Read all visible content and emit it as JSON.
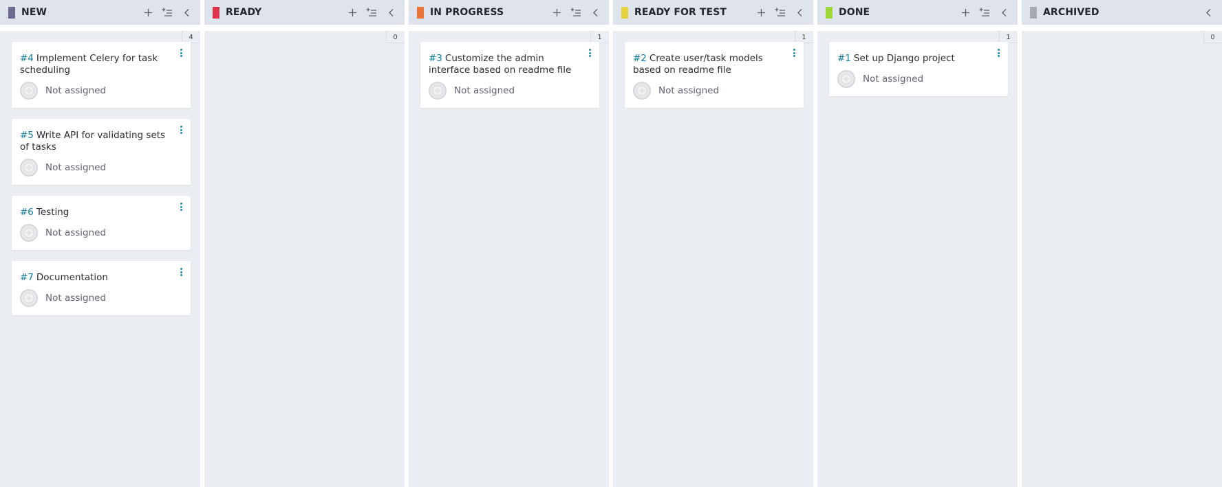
{
  "colors": {
    "header_bg": "#dfe3ec",
    "column_bg": "#eaedf2",
    "card_ref": "#0e7ea3",
    "card_menu": "#1b8fb0"
  },
  "columns": [
    {
      "title": "NEW",
      "color": "#6f6b8f",
      "count": "4",
      "show_add": true,
      "cards": [
        {
          "ref": "#4",
          "title": "Implement Celery for task scheduling",
          "assignee": "Not assigned"
        },
        {
          "ref": "#5",
          "title": "Write API for validating sets of tasks",
          "assignee": "Not assigned"
        },
        {
          "ref": "#6",
          "title": "Testing",
          "assignee": "Not assigned"
        },
        {
          "ref": "#7",
          "title": "Documentation",
          "assignee": "Not assigned"
        }
      ]
    },
    {
      "title": "READY",
      "color": "#e0344a",
      "count": "0",
      "show_add": true,
      "cards": []
    },
    {
      "title": "IN PROGRESS",
      "color": "#e8763a",
      "count": "1",
      "show_add": true,
      "cards": [
        {
          "ref": "#3",
          "title": "Customize the admin interface based on readme file",
          "assignee": "Not assigned"
        }
      ]
    },
    {
      "title": "READY FOR TEST",
      "color": "#e6d23a",
      "count": "1",
      "show_add": true,
      "cards": [
        {
          "ref": "#2",
          "title": "Create user/task models based on readme file",
          "assignee": "Not assigned"
        }
      ]
    },
    {
      "title": "DONE",
      "color": "#9fd63b",
      "count": "1",
      "show_add": true,
      "cards": [
        {
          "ref": "#1",
          "title": "Set up Django project",
          "assignee": "Not assigned"
        }
      ]
    },
    {
      "title": "ARCHIVED",
      "color": "#a7a8b3",
      "count": "0",
      "show_add": false,
      "cards": []
    }
  ]
}
